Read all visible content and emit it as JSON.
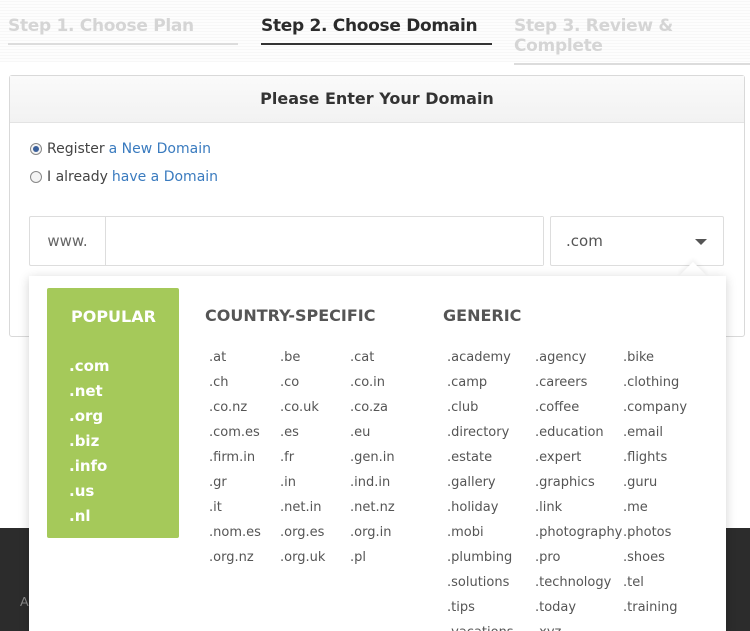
{
  "steps": [
    {
      "label": "Step 1. Choose Plan",
      "state": "inactive"
    },
    {
      "label": "Step 2. Choose Domain",
      "state": "active"
    },
    {
      "label": "Step 3. Review & Complete",
      "state": "inactive"
    }
  ],
  "panel": {
    "title": "Please Enter Your Domain",
    "radio_register": {
      "prefix": "Register",
      "link": "a New Domain",
      "checked": true
    },
    "radio_existing": {
      "prefix": "I already",
      "link": "have a Domain",
      "checked": false
    },
    "prefix": "www.",
    "domain_input": {
      "value": "",
      "placeholder": ""
    },
    "tld_selected": ".com"
  },
  "dropdown": {
    "popular_title": "POPULAR",
    "popular": [
      ".com",
      ".net",
      ".org",
      ".biz",
      ".info",
      ".us",
      ".nl"
    ],
    "country_title": "COUNTRY-SPECIFIC",
    "country": [
      [
        ".at",
        ".be",
        ".cat"
      ],
      [
        ".ch",
        ".co",
        ".co.in"
      ],
      [
        ".co.nz",
        ".co.uk",
        ".co.za"
      ],
      [
        ".com.es",
        ".es",
        ".eu"
      ],
      [
        ".firm.in",
        ".fr",
        ".gen.in"
      ],
      [
        ".gr",
        ".in",
        ".ind.in"
      ],
      [
        ".it",
        ".net.in",
        ".net.nz"
      ],
      [
        ".nom.es",
        ".org.es",
        ".org.in"
      ],
      [
        ".org.nz",
        ".org.uk",
        ".pl"
      ]
    ],
    "generic_title": "GENERIC",
    "generic": [
      [
        ".academy",
        ".agency",
        ".bike"
      ],
      [
        ".camp",
        ".careers",
        ".clothing"
      ],
      [
        ".club",
        ".coffee",
        ".company"
      ],
      [
        ".directory",
        ".education",
        ".email"
      ],
      [
        ".estate",
        ".expert",
        ".flights"
      ],
      [
        ".gallery",
        ".graphics",
        ".guru"
      ],
      [
        ".holiday",
        ".link",
        ".me"
      ],
      [
        ".mobi",
        ".photography",
        ".photos"
      ],
      [
        ".plumbing",
        ".pro",
        ".shoes"
      ],
      [
        ".solutions",
        ".technology",
        ".tel"
      ],
      [
        ".tips",
        ".today",
        ".training"
      ],
      [
        ".vacations",
        ".xyz",
        ""
      ]
    ]
  },
  "colors": {
    "popular_bg": "#a5c95a",
    "link": "#3a7bbf",
    "footer": "#2c2c2c"
  }
}
